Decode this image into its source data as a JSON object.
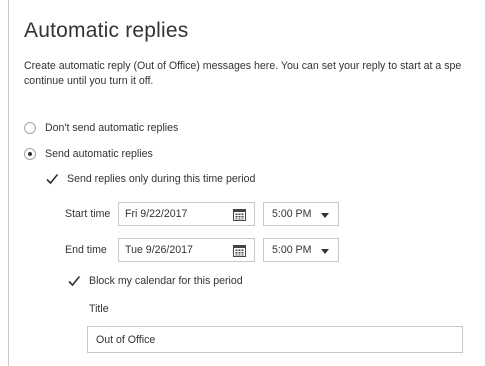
{
  "page": {
    "title": "Automatic replies",
    "description_line1": "Create automatic reply (Out of Office) messages here. You can set your reply to start at a spe",
    "description_line2": "continue until you turn it off."
  },
  "options": {
    "dont_send": {
      "label": "Don't send automatic replies",
      "selected": false
    },
    "send": {
      "label": "Send automatic replies",
      "selected": true
    }
  },
  "time_period": {
    "checkbox_label": "Send replies only during this time period",
    "checked": true,
    "start_label": "Start time",
    "start_date": "Fri 9/22/2017",
    "start_time": "5:00 PM",
    "end_label": "End time",
    "end_date": "Tue 9/26/2017",
    "end_time": "5:00 PM"
  },
  "calendar": {
    "block_label": "Block my calendar for this period",
    "checked": true,
    "title_label": "Title",
    "title_value": "Out of Office"
  },
  "colors": {
    "border": "#c8c8c8",
    "text": "#333333",
    "check": "#333333"
  },
  "icons": {
    "calendar": "calendar-icon",
    "dropdown": "chevron-down-icon",
    "check": "checkmark-icon"
  }
}
